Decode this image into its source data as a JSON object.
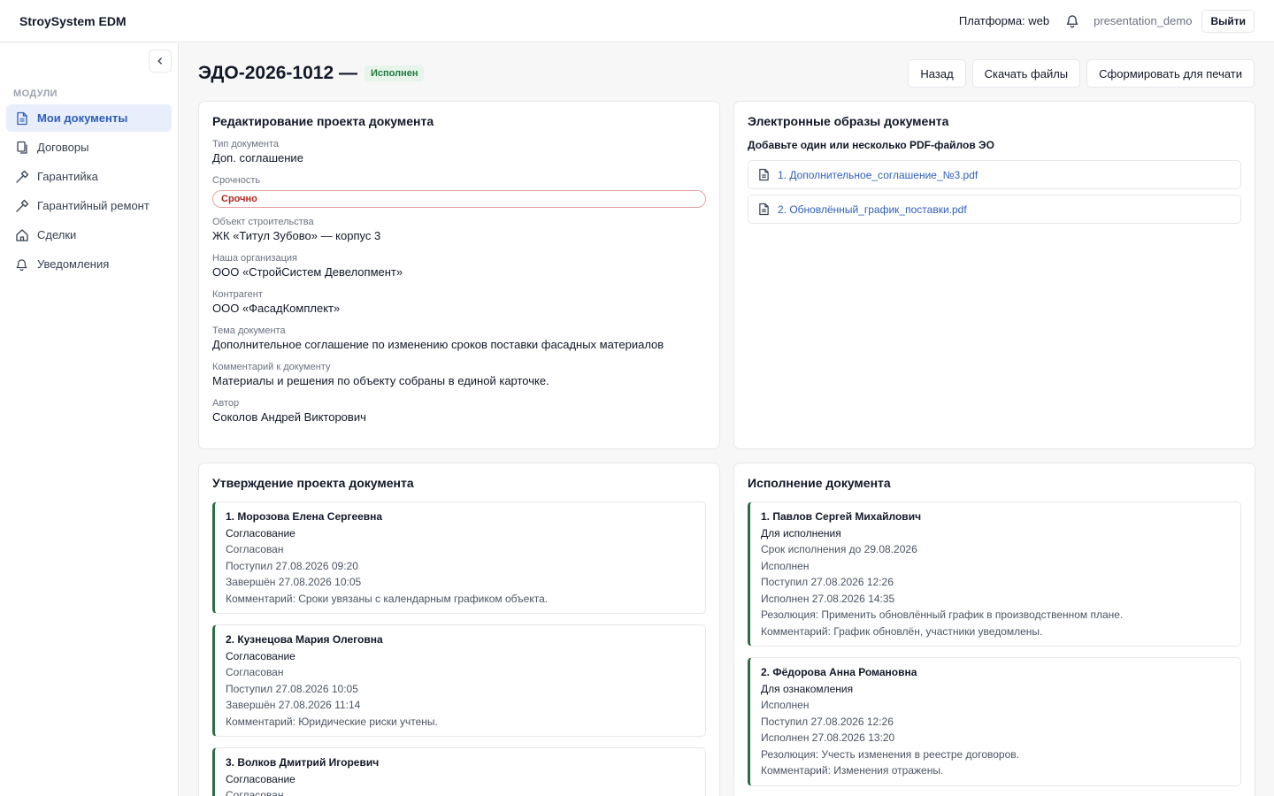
{
  "header": {
    "brand": "StroySystem EDM",
    "platform": "Платформа: web",
    "user": "presentation_demo",
    "logout_label": "Выйти"
  },
  "sidebar": {
    "section_label": "МОДУЛИ",
    "items": [
      {
        "label": "Мои документы",
        "icon": "document-icon",
        "active": true
      },
      {
        "label": "Договоры",
        "icon": "copy-icon",
        "active": false
      },
      {
        "label": "Гарантийка",
        "icon": "hammer-icon",
        "active": false
      },
      {
        "label": "Гарантийный ремонт",
        "icon": "hammer-icon",
        "active": false
      },
      {
        "label": "Сделки",
        "icon": "home-icon",
        "active": false
      },
      {
        "label": "Уведомления",
        "icon": "bell-icon",
        "active": false
      }
    ]
  },
  "page": {
    "title": "ЭДО-2026-1012 —",
    "status": "Исполнен",
    "actions": {
      "back": "Назад",
      "download": "Скачать файлы",
      "print": "Сформировать для печати"
    }
  },
  "edit": {
    "title": "Редактирование проекта документа",
    "fields": [
      {
        "label": "Тип документа",
        "value": "Доп. соглашение"
      },
      {
        "label": "Срочность",
        "value": "Срочно"
      },
      {
        "label": "Объект строительства",
        "value": "ЖК «Титул Зубово» — корпус 3"
      },
      {
        "label": "Наша организация",
        "value": "ООО «СтройСистем Девелопмент»"
      },
      {
        "label": "Контрагент",
        "value": "ООО «ФасадКомплект»"
      },
      {
        "label": "Тема документа",
        "value": "Дополнительное соглашение по изменению сроков поставки фасадных материалов"
      },
      {
        "label": "Комментарий к документу",
        "value": "Материалы и решения по объекту собраны в единой карточке."
      },
      {
        "label": "Автор",
        "value": "Соколов Андрей Викторович"
      }
    ]
  },
  "images": {
    "title": "Электронные образы документа",
    "subtitle": "Добавьте один или несколько PDF-файлов ЭО",
    "files": [
      "1. Дополнительное_соглашение_№3.pdf",
      "2. Обновлённый_график_поставки.pdf"
    ]
  },
  "approval": {
    "title": "Утверждение проекта документа",
    "steps": [
      {
        "name": "1. Морозова Елена Сергеевна",
        "type": "Согласование",
        "lines": [
          "Согласован",
          "Поступил 27.08.2026 09:20",
          "Завершён 27.08.2026 10:05",
          "Комментарий: Сроки увязаны с календарным графиком объекта."
        ]
      },
      {
        "name": "2. Кузнецова Мария Олеговна",
        "type": "Согласование",
        "lines": [
          "Согласован",
          "Поступил 27.08.2026 10:05",
          "Завершён 27.08.2026 11:14",
          "Комментарий: Юридические риски учтены."
        ]
      },
      {
        "name": "3. Волков Дмитрий Игоревич",
        "type": "Согласование",
        "lines": [
          "Согласован"
        ]
      }
    ]
  },
  "execution": {
    "title": "Исполнение документа",
    "steps": [
      {
        "name": "1. Павлов Сергей Михайлович",
        "type": "Для исполнения",
        "lines": [
          "Срок исполнения до 29.08.2026",
          "Исполнен",
          "Поступил 27.08.2026 12:26",
          "Исполнен 27.08.2026 14:35",
          "Резолюция: Применить обновлённый график в производственном плане.",
          "Комментарий: График обновлён, участники уведомлены."
        ]
      },
      {
        "name": "2. Фёдорова Анна Романовна",
        "type": "Для ознакомления",
        "lines": [
          "Исполнен",
          "Поступил 27.08.2026 12:26",
          "Исполнен 27.08.2026 13:20",
          "Резолюция: Учесть изменения в реестре договоров.",
          "Комментарий: Изменения отражены."
        ]
      }
    ]
  }
}
